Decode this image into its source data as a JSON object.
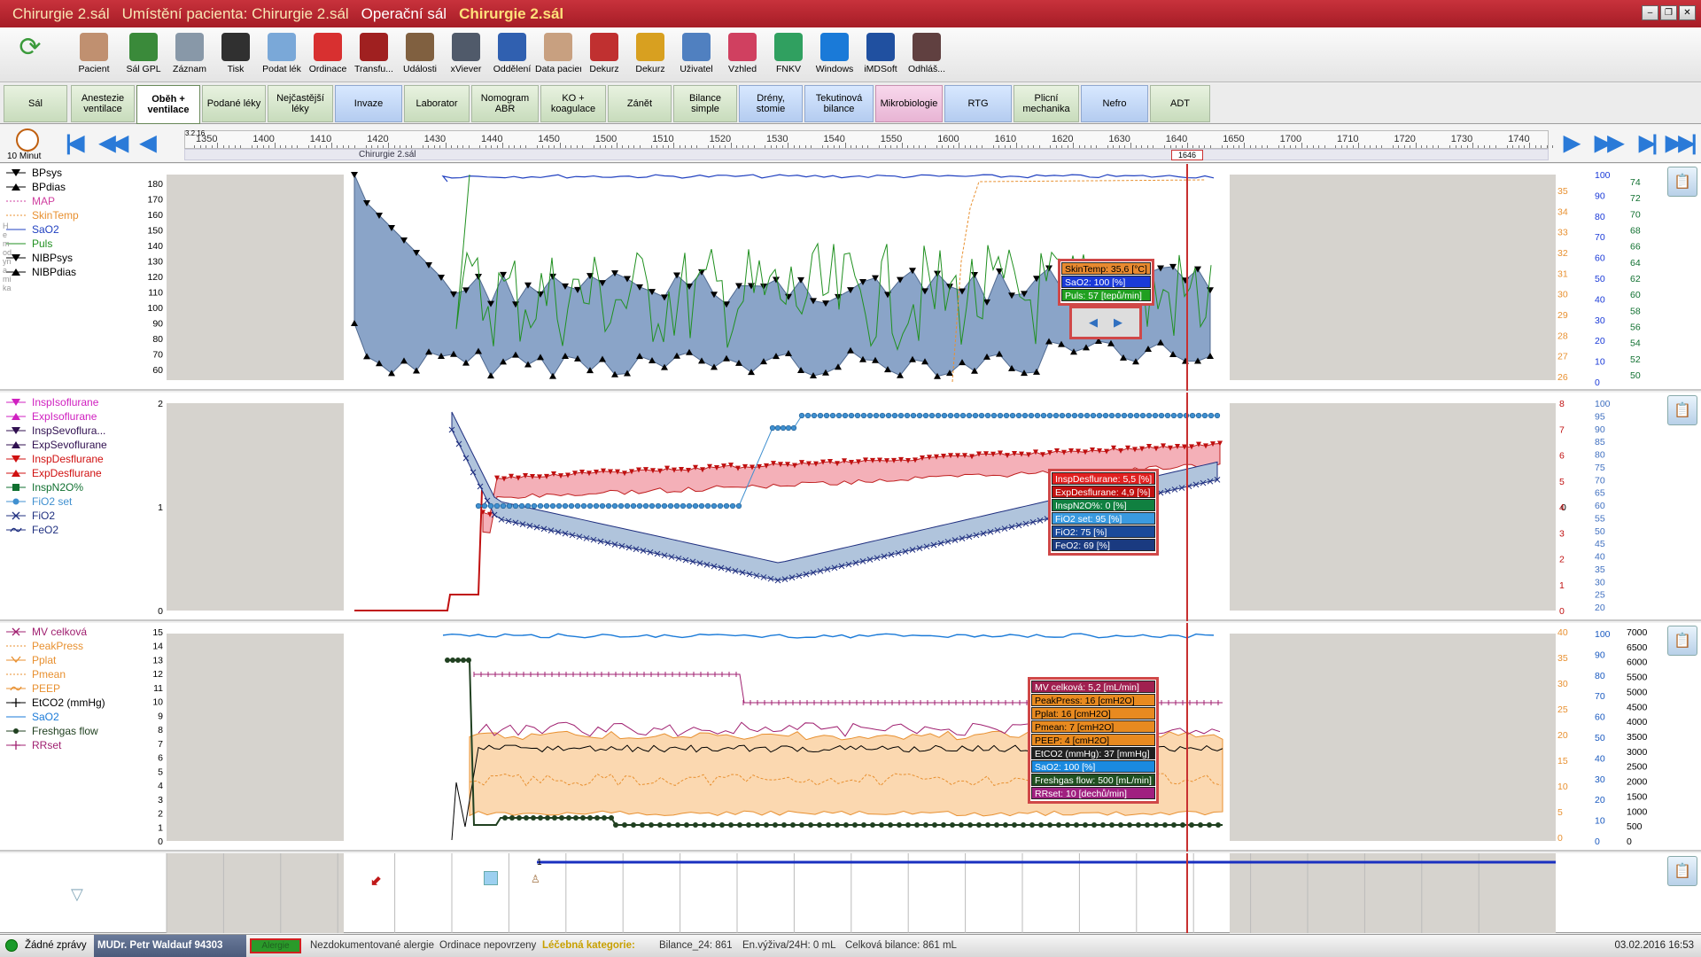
{
  "window": {
    "title_parts": [
      "Chirurgie 2.sál",
      "Umístění pacienta: Chirurgie 2.sál",
      "Operační sál",
      "Chirurgie 2.sál"
    ]
  },
  "toolbar": {
    "items": [
      {
        "label": "",
        "icon": "refresh-icon",
        "color": "#3a9a3a"
      },
      {
        "label": "Pacient",
        "icon": "patient-icon",
        "color": "#c09070"
      },
      {
        "label": "Sál GPL",
        "icon": "folder-icon",
        "color": "#3a8a3a"
      },
      {
        "label": "Záznam",
        "icon": "record-icon",
        "color": "#8898a8"
      },
      {
        "label": "Tisk",
        "icon": "printer-icon",
        "color": "#303030"
      },
      {
        "label": "Podat lék",
        "icon": "syringe-icon",
        "color": "#7aa8d8"
      },
      {
        "label": "Ordinace",
        "icon": "alarm-clock-icon",
        "color": "#d83030"
      },
      {
        "label": "Transfu...",
        "icon": "blood-bag-icon",
        "color": "#a02020"
      },
      {
        "label": "Události",
        "icon": "person-event-icon",
        "color": "#806040"
      },
      {
        "label": "xViever",
        "icon": "xray-icon",
        "color": "#505a6a"
      },
      {
        "label": "Oddělení",
        "icon": "department-icon",
        "color": "#3060b0"
      },
      {
        "label": "Data pacienta",
        "icon": "patient-data-icon",
        "color": "#c8a080"
      },
      {
        "label": "Dekurz",
        "icon": "books-red-icon",
        "color": "#c03030"
      },
      {
        "label": "Dekurz",
        "icon": "books-yellow-icon",
        "color": "#d8a020"
      },
      {
        "label": "Uživatel",
        "icon": "user-icon",
        "color": "#5080c0"
      },
      {
        "label": "Vzhled",
        "icon": "palette-icon",
        "color": "#d04060"
      },
      {
        "label": "FNKV",
        "icon": "fnkv-logo-icon",
        "color": "#30a060"
      },
      {
        "label": "Windows",
        "icon": "windows-logo-icon",
        "color": "#1a7ad8"
      },
      {
        "label": "iMDSoft",
        "icon": "imdsoft-logo-icon",
        "color": "#2050a0"
      },
      {
        "label": "Odhláš...",
        "icon": "logout-icon",
        "color": "#604040"
      }
    ]
  },
  "tabs": [
    {
      "label": "Sál",
      "style": "green"
    },
    {
      "label": "Anestezie ventilace",
      "style": "green"
    },
    {
      "label": "Oběh + ventilace",
      "style": "active"
    },
    {
      "label": "Podané léky",
      "style": "green"
    },
    {
      "label": "Nejčastější léky",
      "style": "green"
    },
    {
      "label": "Invaze",
      "style": "blue"
    },
    {
      "label": "Laborator",
      "style": "green"
    },
    {
      "label": "Nomogram ABR",
      "style": "green"
    },
    {
      "label": "KO + koagulace",
      "style": "green"
    },
    {
      "label": "Zánět",
      "style": "green"
    },
    {
      "label": "Bilance simple",
      "style": "green"
    },
    {
      "label": "Drény, stomie",
      "style": "blue"
    },
    {
      "label": "Tekutinová bilance",
      "style": "blue"
    },
    {
      "label": "Mikrobiologie",
      "style": "pink"
    },
    {
      "label": "RTG",
      "style": "blue"
    },
    {
      "label": "Plicní mechanika",
      "style": "green"
    },
    {
      "label": "Nefro",
      "style": "blue"
    },
    {
      "label": "ADT",
      "style": "green"
    }
  ],
  "ruler": {
    "interval": "10 Minut",
    "date": "3.2.16",
    "ticks": [
      "1350",
      "1400",
      "1410",
      "1420",
      "1430",
      "1440",
      "1450",
      "1500",
      "1510",
      "1520",
      "1530",
      "1540",
      "1550",
      "1600",
      "1610",
      "1620",
      "1630",
      "1640",
      "1650",
      "1700",
      "1710",
      "1720",
      "1730",
      "1740"
    ],
    "location": "Chirurgie 2.sál",
    "cursor_time": "1646"
  },
  "hemo": {
    "legend": [
      {
        "label": "BPsys",
        "color": "#000000",
        "marker": "tri-down"
      },
      {
        "label": "BPdias",
        "color": "#000000",
        "marker": "tri-up"
      },
      {
        "label": "MAP",
        "color": "#d040a0",
        "marker": "dash"
      },
      {
        "label": "SkinTemp",
        "color": "#e89030",
        "marker": "dash"
      },
      {
        "label": "SaO2",
        "color": "#2040c0",
        "marker": "line"
      },
      {
        "label": "Puls",
        "color": "#209020",
        "marker": "line"
      },
      {
        "label": "NIBPsys",
        "color": "#000000",
        "marker": "tri-down"
      },
      {
        "label": "NIBPdias",
        "color": "#000000",
        "marker": "tri-up"
      }
    ],
    "side_label": "Hemodynamika",
    "y_left": [
      "180",
      "170",
      "160",
      "150",
      "140",
      "130",
      "120",
      "110",
      "100",
      "90",
      "80",
      "70",
      "60"
    ],
    "y_temp": [
      "35",
      "34",
      "33",
      "32",
      "31",
      "30",
      "29",
      "28",
      "27",
      "26"
    ],
    "y_sao2": [
      "100",
      "90",
      "80",
      "70",
      "60",
      "50",
      "40",
      "30",
      "20",
      "10",
      "0"
    ],
    "y_puls": [
      "74",
      "72",
      "70",
      "68",
      "66",
      "64",
      "62",
      "60",
      "58",
      "56",
      "54",
      "52",
      "50"
    ],
    "tooltip": [
      {
        "text": "SkinTemp: 35,6 [°C]",
        "bg": "#e88a30",
        "fg": "#000000"
      },
      {
        "text": "SaO2: 100 [%]",
        "bg": "#1a3ad8",
        "fg": "#ffffff"
      },
      {
        "text": "Puls: 57 [tepů/min]",
        "bg": "#20a020",
        "fg": "#ffffff"
      }
    ]
  },
  "vent": {
    "legend": [
      {
        "label": "InspIsoflurane",
        "color": "#d020c0",
        "marker": "tri-down"
      },
      {
        "label": "ExpIsoflurane",
        "color": "#d020c0",
        "marker": "tri-up"
      },
      {
        "label": "InspSevoflura...",
        "color": "#301050",
        "marker": "tri-down"
      },
      {
        "label": "ExpSevoflurane",
        "color": "#301050",
        "marker": "tri-up"
      },
      {
        "label": "InspDesflurane",
        "color": "#d01010",
        "marker": "tri-down"
      },
      {
        "label": "ExpDesflurane",
        "color": "#d01010",
        "marker": "tri-up"
      },
      {
        "label": "InspN2O%",
        "color": "#107030",
        "marker": "square"
      },
      {
        "label": "FiO2 set",
        "color": "#4090d0",
        "marker": "circle"
      },
      {
        "label": "FiO2",
        "color": "#203080",
        "marker": "x"
      },
      {
        "label": "FeO2",
        "color": "#203080",
        "marker": "tilde"
      }
    ],
    "y_left": [
      "2",
      "1",
      "0"
    ],
    "y_mid": [
      "0"
    ],
    "y_red": [
      "8",
      "7",
      "6",
      "5",
      "4",
      "3",
      "2",
      "1",
      "0"
    ],
    "y_right": [
      "100",
      "95",
      "90",
      "85",
      "80",
      "75",
      "70",
      "65",
      "60",
      "55",
      "50",
      "45",
      "40",
      "35",
      "30",
      "25",
      "20"
    ],
    "tooltip": [
      {
        "text": "InspDesflurane: 5,5 [%]",
        "bg": "#e02020",
        "fg": "#ffffff"
      },
      {
        "text": "ExpDesflurane: 4,9 [%]",
        "bg": "#c01010",
        "fg": "#ffffff"
      },
      {
        "text": "InspN2O%: 0 [%]",
        "bg": "#108040",
        "fg": "#ffffff"
      },
      {
        "text": "FiO2 set: 95 [%]",
        "bg": "#3a9ae0",
        "fg": "#ffffff"
      },
      {
        "text": "FiO2: 75 [%]",
        "bg": "#1a4a9a",
        "fg": "#ffffff"
      },
      {
        "text": "FeO2: 69 [%]",
        "bg": "#1a3a80",
        "fg": "#ffffff"
      }
    ]
  },
  "resp": {
    "legend": [
      {
        "label": "MV celková",
        "color": "#a02070",
        "marker": "x"
      },
      {
        "label": "PeakPress",
        "color": "#e89030",
        "marker": "dash"
      },
      {
        "label": "Pplat",
        "color": "#e89030",
        "marker": "v"
      },
      {
        "label": "Pmean",
        "color": "#e89030",
        "marker": "dash"
      },
      {
        "label": "PEEP",
        "color": "#e89030",
        "marker": "tilde"
      },
      {
        "label": "EtCO2 (mmHg)",
        "color": "#000000",
        "marker": "plus"
      },
      {
        "label": "SaO2",
        "color": "#1a7ad8",
        "marker": "line"
      },
      {
        "label": "Freshgas flow",
        "color": "#204020",
        "marker": "dot"
      },
      {
        "label": "RRset",
        "color": "#a02070",
        "marker": "plus"
      }
    ],
    "y_left": [
      "15",
      "14",
      "13",
      "12",
      "11",
      "10",
      "9",
      "8",
      "7",
      "6",
      "5",
      "4",
      "3",
      "2",
      "1",
      "0"
    ],
    "y_press": [
      "40",
      "35",
      "30",
      "25",
      "20",
      "15",
      "10",
      "5",
      "0"
    ],
    "y_sao2": [
      "100",
      "90",
      "80",
      "70",
      "60",
      "50",
      "40",
      "30",
      "20",
      "10",
      "0"
    ],
    "y_flow": [
      "7000",
      "6500",
      "6000",
      "5500",
      "5000",
      "4500",
      "4000",
      "3500",
      "3000",
      "2500",
      "2000",
      "1500",
      "1000",
      "500",
      "0"
    ],
    "tooltip": [
      {
        "text": "MV celková: 5,2 [mL/min]",
        "bg": "#a02050",
        "fg": "#ffffff"
      },
      {
        "text": "PeakPress: 16 [cmH2O]",
        "bg": "#e88a20",
        "fg": "#000000"
      },
      {
        "text": "Pplat: 16 [cmH2O]",
        "bg": "#e88a20",
        "fg": "#000000"
      },
      {
        "text": "Pmean: 7 [cmH2O]",
        "bg": "#e88a20",
        "fg": "#000000"
      },
      {
        "text": "PEEP: 4 [cmH2O]",
        "bg": "#e88a20",
        "fg": "#000000"
      },
      {
        "text": "EtCO2 (mmHg): 37 [mmHg]",
        "bg": "#202020",
        "fg": "#ffffff"
      },
      {
        "text": "SaO2: 100 [%]",
        "bg": "#1a8ae0",
        "fg": "#ffffff"
      },
      {
        "text": "Freshgas flow: 500 [mL/min]",
        "bg": "#205020",
        "fg": "#ffffff"
      },
      {
        "text": "RRset: 10 [dechů/min]",
        "bg": "#a02080",
        "fg": "#ffffff"
      }
    ]
  },
  "events": {
    "marker_label": "1"
  },
  "status": {
    "messages": "Žádné zprávy",
    "doctor": "MUDr. Petr Waldauf  94303",
    "allergy_badge": "Alergie",
    "allergy": "Nezdokumentované alergie",
    "orders": "Ordinace nepovrzeny",
    "category_label": "Léčebná kategorie:",
    "bilance24": "Bilance_24: 861",
    "nutrition": "En.výživa/24H: 0 mL",
    "total": "Celková bilance: 861 mL",
    "datetime": "03.02.2016 16:53"
  }
}
